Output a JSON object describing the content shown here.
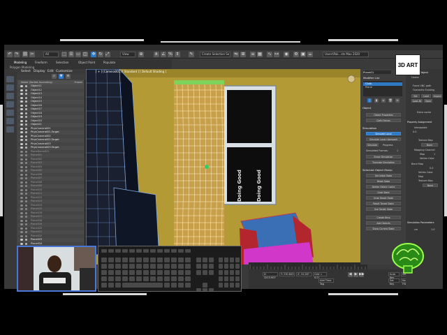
{
  "colors": {
    "viewport_bg": "#a28c2e",
    "wall": "#b39a35",
    "curtain": "#c8a04c",
    "curtain_rod": "#7ed35a",
    "armchair_red": "#b3262e",
    "armchair_blue": "#3b6fb5",
    "armchair_base": "#d137c8",
    "accent_blue": "#2f78c4",
    "frame_deco": "#d8d8d8"
  },
  "ribbon": {
    "tabs": [
      "Modeling",
      "Freeform",
      "Selection",
      "Object Paint",
      "Populate"
    ],
    "subtitle": "Polygon Modeling"
  },
  "toolbar": {
    "view_dropdown": "All",
    "coord_dropdown": "View",
    "selection_set": "Create Selection Se",
    "workspace": "Users\\Pak...sts Max 2020"
  },
  "scene_explorer": {
    "menu": [
      "Select",
      "Display",
      "Edit",
      "Customize"
    ],
    "column_header": "Name (Sorted Ascending)",
    "column_frozen": "Frozen",
    "items": [
      {
        "name": "Object11",
        "dim": false
      },
      {
        "name": "Object12",
        "dim": false
      },
      {
        "name": "Object13",
        "dim": false
      },
      {
        "name": "Object14",
        "dim": false
      },
      {
        "name": "Object15",
        "dim": false
      },
      {
        "name": "Object16",
        "dim": false
      },
      {
        "name": "Object17",
        "dim": false
      },
      {
        "name": "Object18",
        "dim": false
      },
      {
        "name": "Object19",
        "dim": false
      },
      {
        "name": "Object20",
        "dim": false
      },
      {
        "name": "Object21",
        "dim": false
      },
      {
        "name": "PhysCamera001",
        "dim": false
      },
      {
        "name": "PhysCamera001.Target",
        "dim": false
      },
      {
        "name": "PhysCamera002",
        "dim": false
      },
      {
        "name": "PhysCamera002.Target",
        "dim": false
      },
      {
        "name": "PhysCamera003",
        "dim": false
      },
      {
        "name": "PhysCamera003.Target",
        "dim": false
      },
      {
        "name": "PlaneDome001",
        "dim": true
      },
      {
        "name": "Plane001",
        "dim": true
      },
      {
        "name": "Plane002",
        "dim": true
      },
      {
        "name": "Plane003",
        "dim": true
      },
      {
        "name": "Plane004",
        "dim": true
      },
      {
        "name": "Plane005",
        "dim": true
      },
      {
        "name": "Plane006",
        "dim": true
      },
      {
        "name": "Plane007",
        "dim": true
      },
      {
        "name": "Plane008",
        "dim": true
      },
      {
        "name": "Plane009",
        "dim": true
      },
      {
        "name": "Plane010",
        "dim": true
      },
      {
        "name": "Plane011",
        "dim": true
      },
      {
        "name": "Plane012",
        "dim": true
      },
      {
        "name": "Plane013",
        "dim": true
      },
      {
        "name": "Plane014",
        "dim": true
      },
      {
        "name": "Plane015",
        "dim": true
      },
      {
        "name": "Plane016",
        "dim": true
      },
      {
        "name": "Plane017",
        "dim": true
      },
      {
        "name": "Plane018",
        "dim": true
      },
      {
        "name": "Plane019",
        "dim": true
      },
      {
        "name": "Plane020",
        "dim": true
      },
      {
        "name": "Plane021",
        "dim": true
      },
      {
        "name": "Plane022",
        "dim": true
      },
      {
        "name": "Plane023",
        "dim": false
      },
      {
        "name": "Plane024",
        "dim": false
      }
    ]
  },
  "viewport": {
    "label": "[ + ] [Camera001] [ Standard ] [ Default Shading ]",
    "poster_text_1": "Doing Good",
    "poster_text_2": "Doing Good"
  },
  "command_panel": {
    "object_name": "Plane01",
    "modifier_list": "Modifier List",
    "stack_items": [
      "Cloth",
      "Plane"
    ],
    "object_header": "Object",
    "object_buttons": [
      "Object Properties",
      "Cloth Forces"
    ],
    "simulation_header": "Simulation",
    "sim_buttons": [
      "Simulate Local",
      "Simulate Local (damped)"
    ],
    "simulate_label": "Simulate",
    "progress_label": "Progress",
    "sim_frames_label": "Simulated Frames:",
    "sim_frames_value": "1",
    "sim_buttons_2": [
      "Erase Simulation",
      "Truncate Simulation"
    ],
    "selected_header": "Selected Object Manip",
    "manip_buttons": [
      "Set Initial State",
      "Reset State",
      "Delete Object Cache",
      "Grab State",
      "Grab Target State",
      "Reset Target State",
      "Use Target State"
    ],
    "create_keys": "Create Keys",
    "add_objects": "Add Objects",
    "show_current": "Show Current State"
  },
  "properties": {
    "selected_object": "Selected Object",
    "cache_label": "Cache",
    "force_unc": "Force UNC path",
    "overwrite": "Overwrite Existing",
    "btn_set": "Set",
    "btn_load": "Load",
    "btn_import": "Import",
    "btn_load_all": "Load All",
    "btn_save": "Save",
    "extra_cache": "Extra cache",
    "property_assignment": "Property Assignment",
    "interpolate": "Interpolate",
    "value_zero": "0.0",
    "texture_map": "Texture Map",
    "none": "None",
    "mapping_channel": "Mapping Channel",
    "map_label": "Map",
    "map_value": "1",
    "vertex_color": "Vertex Color",
    "bend_map": "Bend Map",
    "bend_value": "0.0",
    "texture_map_2": "Texture Map",
    "sim_params": "Simulation Parameters",
    "cm_label": "cm",
    "unit_value": "1.0"
  },
  "status": {
    "x": "X: 3213.907",
    "y": "Y: 230.843",
    "z": "Z: 10.287",
    "grid": "Grid = 0.0\"",
    "add_time_tag": "Add Time Tag",
    "auto_key": "Auto Key",
    "set_key": "Set Key",
    "selected": "Selected",
    "key_filters": "Key Filters..."
  },
  "brand": {
    "label": "3D ART"
  }
}
